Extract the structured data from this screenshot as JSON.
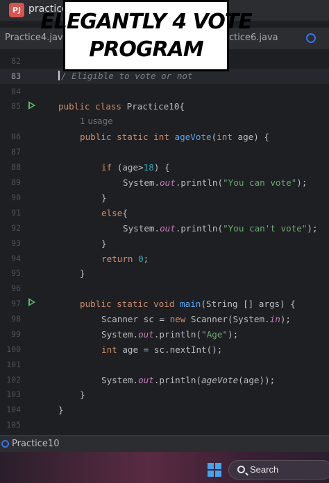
{
  "window": {
    "project_badge": "PJ",
    "project_name": "practice"
  },
  "tabs": [
    {
      "label": "Practice4.java"
    },
    {
      "label": "ctice6.java"
    }
  ],
  "caption": {
    "line1": "ELEGANTLY 4 VOTE",
    "line2": "PROGRAM"
  },
  "editor": {
    "active_line": "83",
    "line_numbers": [
      "82",
      "83",
      "84",
      "85",
      "86",
      "87",
      "88",
      "89",
      "90",
      "91",
      "92",
      "93",
      "94",
      "95",
      "96",
      "97",
      "98",
      "99",
      "100",
      "101",
      "102",
      "103",
      "104",
      "105"
    ],
    "comment_text": "Eligible to vote or not",
    "usage_hint": "1 usage",
    "code": {
      "class_decl": [
        "public class ",
        "Practice10",
        "{"
      ],
      "method_decl": [
        "public static int ",
        "ageVote",
        "(",
        "int",
        " age) {"
      ],
      "if_line": [
        "if",
        " (age>",
        "18",
        ") {"
      ],
      "print1": [
        "System.",
        "out",
        ".println(",
        "\"You can vote\"",
        ");"
      ],
      "close1": "}",
      "else_line": [
        "else",
        "{"
      ],
      "print2": [
        "System.",
        "out",
        ".println(",
        "\"You can't vote\"",
        ");"
      ],
      "close2": "}",
      "return_line": [
        "return ",
        "0",
        ";"
      ],
      "close3": "}",
      "main_decl": [
        "public static void ",
        "main",
        "(String [] args) {"
      ],
      "scanner_line": [
        "Scanner sc = ",
        "new",
        " Scanner(System.",
        "in",
        ");"
      ],
      "print_age": [
        "System.",
        "out",
        ".println(",
        "\"Age\"",
        ");"
      ],
      "int_line": [
        "int",
        " age = sc.nextInt();"
      ],
      "print_vote": [
        "System.",
        "out",
        ".println(",
        "ageVote",
        "(age));"
      ],
      "close4": "}",
      "close5": "}"
    }
  },
  "statusbar": {
    "file_label": "Practice10"
  },
  "taskbar": {
    "search_label": "Search"
  },
  "colors": {
    "editor_bg": "#1e1f22",
    "keyword": "#cf8e6d",
    "function": "#56a8f5",
    "string": "#6aab73",
    "number": "#2aacb8",
    "field": "#c77dbb",
    "run_icon": "#5fb865"
  }
}
